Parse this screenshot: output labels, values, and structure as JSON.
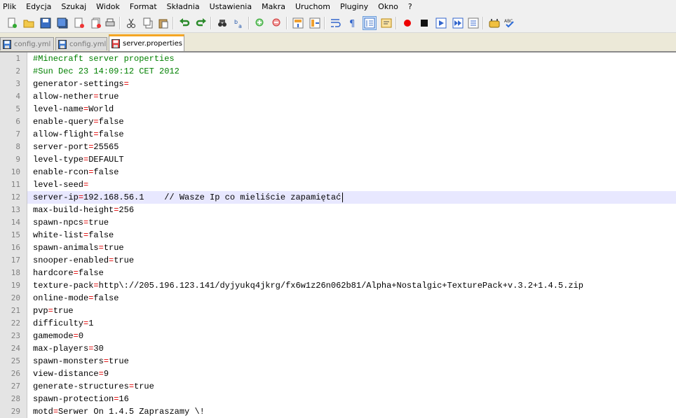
{
  "menu": [
    "Plik",
    "Edycja",
    "Szukaj",
    "Widok",
    "Format",
    "Składnia",
    "Ustawienia",
    "Makra",
    "Uruchom",
    "Pluginy",
    "Okno",
    "?"
  ],
  "toolbar": {
    "buttons": [
      {
        "name": "new-file-icon",
        "kind": "new"
      },
      {
        "name": "open-file-icon",
        "kind": "open"
      },
      {
        "name": "save-icon",
        "kind": "save"
      },
      {
        "name": "save-all-icon",
        "kind": "saveall"
      },
      {
        "name": "close-icon",
        "kind": "close"
      },
      {
        "name": "close-all-icon",
        "kind": "closeall"
      },
      {
        "name": "print-icon",
        "kind": "print"
      },
      {
        "name": "cut-icon",
        "kind": "cut"
      },
      {
        "name": "copy-icon",
        "kind": "copy"
      },
      {
        "name": "paste-icon",
        "kind": "paste"
      },
      {
        "name": "undo-icon",
        "kind": "undo"
      },
      {
        "name": "redo-icon",
        "kind": "redo"
      },
      {
        "name": "find-icon",
        "kind": "find"
      },
      {
        "name": "replace-icon",
        "kind": "replace"
      },
      {
        "name": "zoom-in-icon",
        "kind": "zoomin"
      },
      {
        "name": "zoom-out-icon",
        "kind": "zoomout"
      },
      {
        "name": "sync-vertical-icon",
        "kind": "syncv"
      },
      {
        "name": "sync-horizontal-icon",
        "kind": "synch"
      },
      {
        "name": "word-wrap-icon",
        "kind": "wrap"
      },
      {
        "name": "show-all-chars-icon",
        "kind": "pilcrow"
      },
      {
        "name": "indent-guide-icon",
        "kind": "indent"
      },
      {
        "name": "user-language-icon",
        "kind": "udl"
      },
      {
        "name": "record-macro-icon",
        "kind": "record"
      },
      {
        "name": "stop-macro-icon",
        "kind": "stop"
      },
      {
        "name": "play-macro-icon",
        "kind": "play"
      },
      {
        "name": "play-multiple-macro-icon",
        "kind": "playmulti"
      },
      {
        "name": "save-macro-icon",
        "kind": "savemacro"
      },
      {
        "name": "plugin-icon",
        "kind": "plugin"
      },
      {
        "name": "spell-check-icon",
        "kind": "spell"
      }
    ]
  },
  "tabs": [
    {
      "label": "config.yml",
      "active": false
    },
    {
      "label": "config.yml",
      "active": false
    },
    {
      "label": "server.properties",
      "active": true
    }
  ],
  "editor": {
    "current_line": 12,
    "lines": [
      {
        "n": "1",
        "text": "#Minecraft server properties",
        "comment": true
      },
      {
        "n": "2",
        "text": "#Sun Dec 23 14:09:12 CET 2012",
        "comment": true
      },
      {
        "n": "3",
        "key": "generator-settings",
        "value": ""
      },
      {
        "n": "4",
        "key": "allow-nether",
        "value": "true"
      },
      {
        "n": "5",
        "key": "level-name",
        "value": "World"
      },
      {
        "n": "6",
        "key": "enable-query",
        "value": "false"
      },
      {
        "n": "7",
        "key": "allow-flight",
        "value": "false"
      },
      {
        "n": "8",
        "key": "server-port",
        "value": "25565"
      },
      {
        "n": "9",
        "key": "level-type",
        "value": "DEFAULT"
      },
      {
        "n": "10",
        "key": "enable-rcon",
        "value": "false"
      },
      {
        "n": "11",
        "key": "level-seed",
        "value": ""
      },
      {
        "n": "12",
        "key": "server-ip",
        "value": "192.168.56.1    // Wasze Ip co mieliście zapamiętać"
      },
      {
        "n": "13",
        "key": "max-build-height",
        "value": "256"
      },
      {
        "n": "14",
        "key": "spawn-npcs",
        "value": "true"
      },
      {
        "n": "15",
        "key": "white-list",
        "value": "false"
      },
      {
        "n": "16",
        "key": "spawn-animals",
        "value": "true"
      },
      {
        "n": "17",
        "key": "snooper-enabled",
        "value": "true"
      },
      {
        "n": "18",
        "key": "hardcore",
        "value": "false"
      },
      {
        "n": "19",
        "key": "texture-pack",
        "value": "http\\://205.196.123.141/dyjyukq4jkrg/fx6w1z26n062b81/Alpha+Nostalgic+TexturePack+v.3.2+1.4.5.zip"
      },
      {
        "n": "20",
        "key": "online-mode",
        "value": "false"
      },
      {
        "n": "21",
        "key": "pvp",
        "value": "true"
      },
      {
        "n": "22",
        "key": "difficulty",
        "value": "1"
      },
      {
        "n": "23",
        "key": "gamemode",
        "value": "0"
      },
      {
        "n": "24",
        "key": "max-players",
        "value": "30"
      },
      {
        "n": "25",
        "key": "spawn-monsters",
        "value": "true"
      },
      {
        "n": "26",
        "key": "view-distance",
        "value": "9"
      },
      {
        "n": "27",
        "key": "generate-structures",
        "value": "true"
      },
      {
        "n": "28",
        "key": "spawn-protection",
        "value": "16"
      },
      {
        "n": "29",
        "key": "motd",
        "value": "Serwer On 1.4.5 Zapraszamy \\!"
      }
    ]
  },
  "colors": {
    "comment": "#008000",
    "operator": "#e00000",
    "current_line_bg": "#e8e8ff",
    "gutter_bg": "#e4e4e4",
    "active_tab_accent": "#f5a623"
  }
}
